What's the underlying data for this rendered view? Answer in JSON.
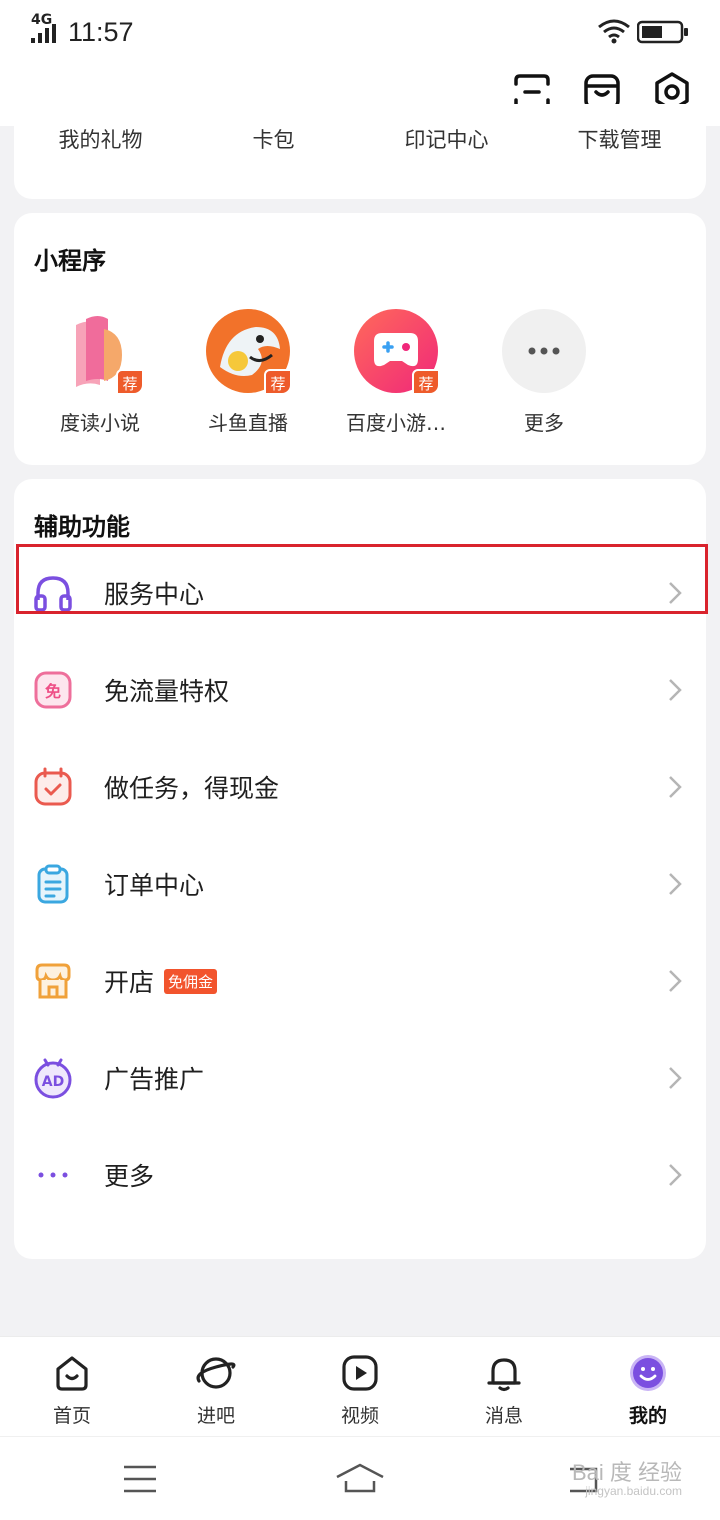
{
  "status": {
    "network": "4G",
    "time": "11:57"
  },
  "top_icons": [
    "scan-icon",
    "store-box-icon",
    "settings-icon"
  ],
  "gifts": [
    "我的礼物",
    "卡包",
    "印记中心",
    "下载管理"
  ],
  "mini_programs": {
    "title": "小程序",
    "items": [
      {
        "label": "度读小说",
        "badge": "荐"
      },
      {
        "label": "斗鱼直播",
        "badge": "荐"
      },
      {
        "label": "百度小游…",
        "badge": "荐"
      },
      {
        "label": "更多"
      }
    ]
  },
  "aux": {
    "title": "辅助功能",
    "items": [
      {
        "label": "服务中心"
      },
      {
        "label": "免流量特权",
        "icon_text": "免"
      },
      {
        "label": "做任务，得现金"
      },
      {
        "label": "订单中心"
      },
      {
        "label": "开店",
        "tag": "免佣金"
      },
      {
        "label": "广告推广",
        "icon_text": "AD"
      },
      {
        "label": "更多"
      }
    ]
  },
  "tabs": [
    {
      "label": "首页"
    },
    {
      "label": "进吧"
    },
    {
      "label": "视频"
    },
    {
      "label": "消息"
    },
    {
      "label": "我的",
      "active": true
    }
  ],
  "watermark": {
    "brand": "Bai 度 经验",
    "url": "jingyan.baidu.com"
  },
  "colors": {
    "accent": "#7b4fe0",
    "highlight": "#d9232d",
    "badge": "#ee5b2b"
  }
}
